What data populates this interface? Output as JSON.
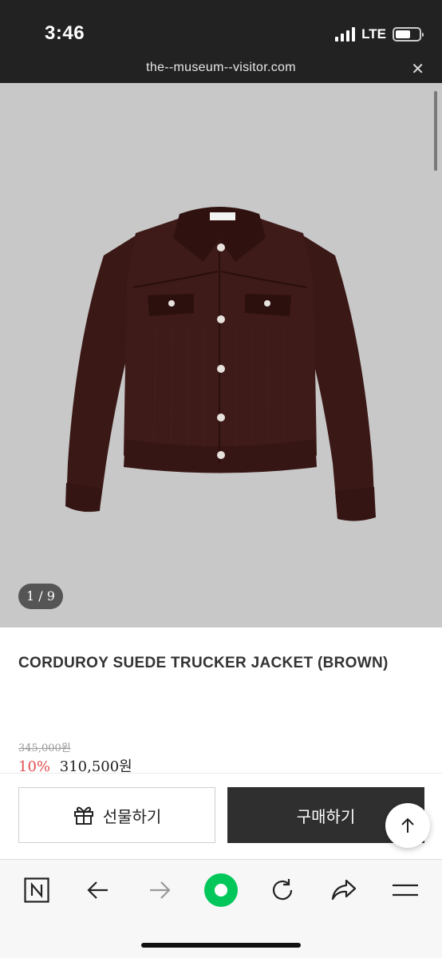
{
  "status_bar": {
    "time": "3:46",
    "network": "LTE",
    "signal_bars": 4,
    "battery_level": 0.65
  },
  "url_bar": {
    "url": "the--museum--visitor.com",
    "close_icon": "close-icon"
  },
  "gallery": {
    "counter": "1 / 9",
    "image_subject": "brown corduroy suede trucker jacket"
  },
  "product": {
    "title": "CORDUROY SUEDE TRUCKER JACKET (BROWN)",
    "original_price": "345,000원",
    "discount": "10%",
    "price": "310,500원"
  },
  "actions": {
    "gift_label": "선물하기",
    "buy_label": "구매하기",
    "gift_icon": "gift-icon",
    "top_icon": "arrow-up-icon"
  },
  "browser_toolbar": {
    "items": [
      "naver-home-icon",
      "back-arrow-icon",
      "forward-arrow-icon",
      "green-dot-icon",
      "reload-icon",
      "share-icon",
      "menu-icon"
    ]
  },
  "colors": {
    "topbar": "#222222",
    "image_bg": "#c8c8c8",
    "discount": "#e14d4d",
    "buy_button": "#2f2f2f",
    "naver_green": "#03c75a"
  }
}
